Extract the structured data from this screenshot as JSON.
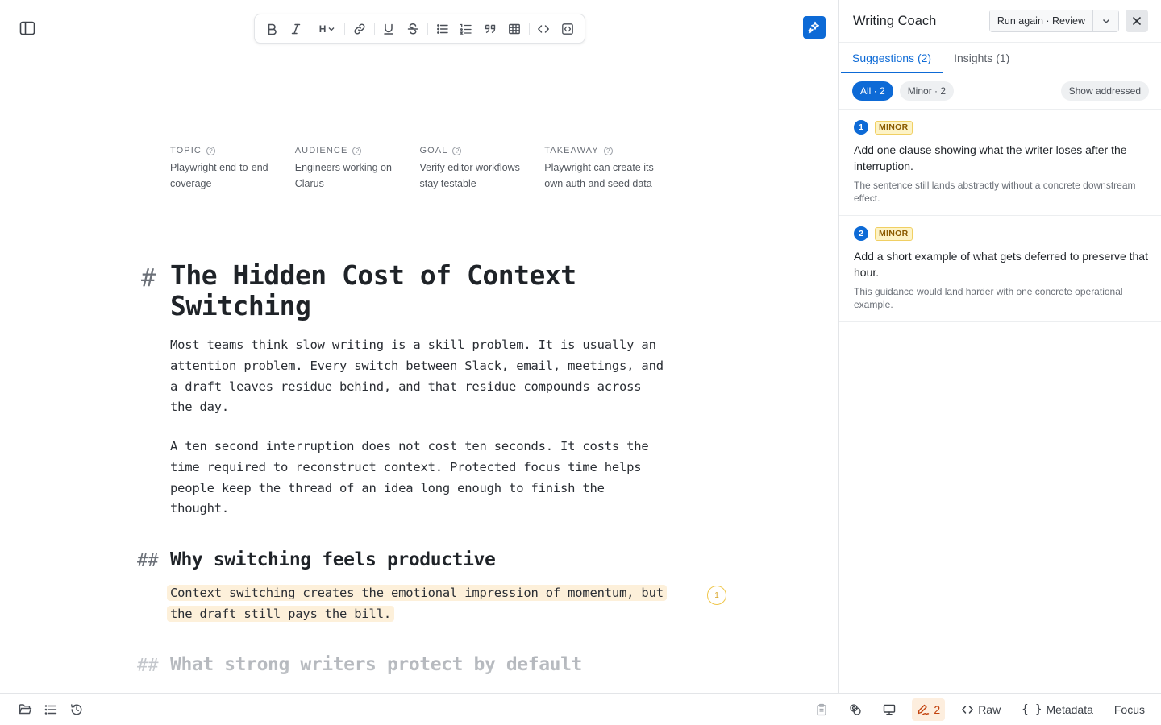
{
  "toolbar": {
    "heading_label": "H"
  },
  "metadata": [
    {
      "label": "TOPIC",
      "value": "Playwright end-to-end coverage"
    },
    {
      "label": "AUDIENCE",
      "value": "Engineers working on Clarus"
    },
    {
      "label": "GOAL",
      "value": "Verify editor workflows stay testable"
    },
    {
      "label": "TAKEAWAY",
      "value": "Playwright can create its own auth and seed data"
    }
  ],
  "help_glyph": "?",
  "document": {
    "h1_marker": "#",
    "title": "The Hidden Cost of Context Switching",
    "paragraph_1": "Most teams think slow writing is a skill problem. It is usually an attention problem. Every switch between Slack, email, meetings, and a draft leaves residue behind, and that residue compounds across the day.",
    "paragraph_2": "A ten second interruption does not cost ten seconds. It costs the time required to reconstruct context. Protected focus time helps people keep the thread of an idea long enough to finish the thought.",
    "h2_marker": "##",
    "section_1_heading": "Why switching feels productive",
    "highlighted_paragraph": "Context switching creates the emotional impression of momentum, but the draft still pays the bill.",
    "marker_number": "1",
    "section_2_heading": "What strong writers protect by default"
  },
  "coach": {
    "title": "Writing Coach",
    "run_again_label": "Run again · Review",
    "tabs": [
      {
        "label": "Suggestions (2)",
        "active": true
      },
      {
        "label": "Insights (1)",
        "active": false
      }
    ],
    "filters": [
      {
        "label": "All · 2",
        "active": true
      },
      {
        "label": "Minor · 2",
        "active": false
      }
    ],
    "show_addressed_label": "Show addressed",
    "suggestions": [
      {
        "number": "1",
        "severity": "MINOR",
        "title": "Add one clause showing what the writer loses after the interruption.",
        "description": "The sentence still lands abstractly without a concrete downstream effect."
      },
      {
        "number": "2",
        "severity": "MINOR",
        "title": "Add a short example of what gets deferred to preserve that hour.",
        "description": "This guidance would land harder with one concrete operational example."
      }
    ]
  },
  "statusbar": {
    "suggestion_count": "2",
    "raw_label": "Raw",
    "metadata_label": "Metadata",
    "focus_label": "Focus"
  },
  "colors": {
    "accent": "#0d6ad6",
    "highlight": "#fdf0da",
    "minor_badge": "#fdf3c6",
    "marker": "#efc64a"
  },
  "icons": [
    "sidebar-toggle-icon",
    "bold-icon",
    "italic-icon",
    "link-icon",
    "underline-icon",
    "strikethrough-icon",
    "bullet-list-icon",
    "numbered-list-icon",
    "quote-icon",
    "table-icon",
    "code-icon",
    "code-block-icon",
    "sparkle-icon",
    "chevron-down-icon",
    "close-icon",
    "folder-icon",
    "outline-icon",
    "history-icon",
    "clipboard-icon",
    "link-check-icon",
    "monitor-icon",
    "pen-icon"
  ]
}
